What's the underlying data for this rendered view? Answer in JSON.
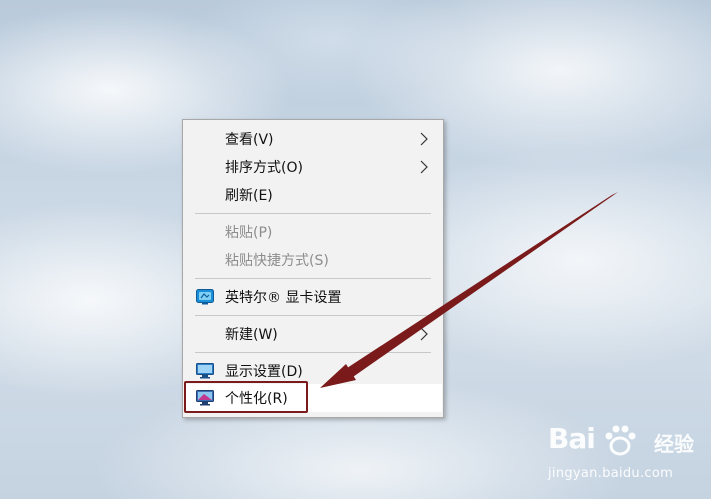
{
  "context_menu": {
    "items": [
      {
        "label": "查看(V)",
        "has_submenu": true,
        "enabled": true
      },
      {
        "label": "排序方式(O)",
        "has_submenu": true,
        "enabled": true
      },
      {
        "label": "刷新(E)",
        "has_submenu": false,
        "enabled": true
      },
      {
        "label": "粘贴(P)",
        "has_submenu": false,
        "enabled": false
      },
      {
        "label": "粘贴快捷方式(S)",
        "has_submenu": false,
        "enabled": false
      },
      {
        "label": "英特尔® 显卡设置",
        "has_submenu": false,
        "enabled": true,
        "icon": "intel-graphics-icon"
      },
      {
        "label": "新建(W)",
        "has_submenu": true,
        "enabled": true
      },
      {
        "label": "显示设置(D)",
        "has_submenu": false,
        "enabled": true,
        "icon": "display-monitor-icon"
      },
      {
        "label": "个性化(R)",
        "has_submenu": false,
        "enabled": true,
        "icon": "personalize-icon",
        "highlighted": true
      }
    ]
  },
  "annotation": {
    "color": "#7a1a1a",
    "target": "个性化(R)"
  },
  "watermark": {
    "brand": "Bai",
    "brand_suffix": "经验",
    "url": "jingyan.baidu.com"
  }
}
